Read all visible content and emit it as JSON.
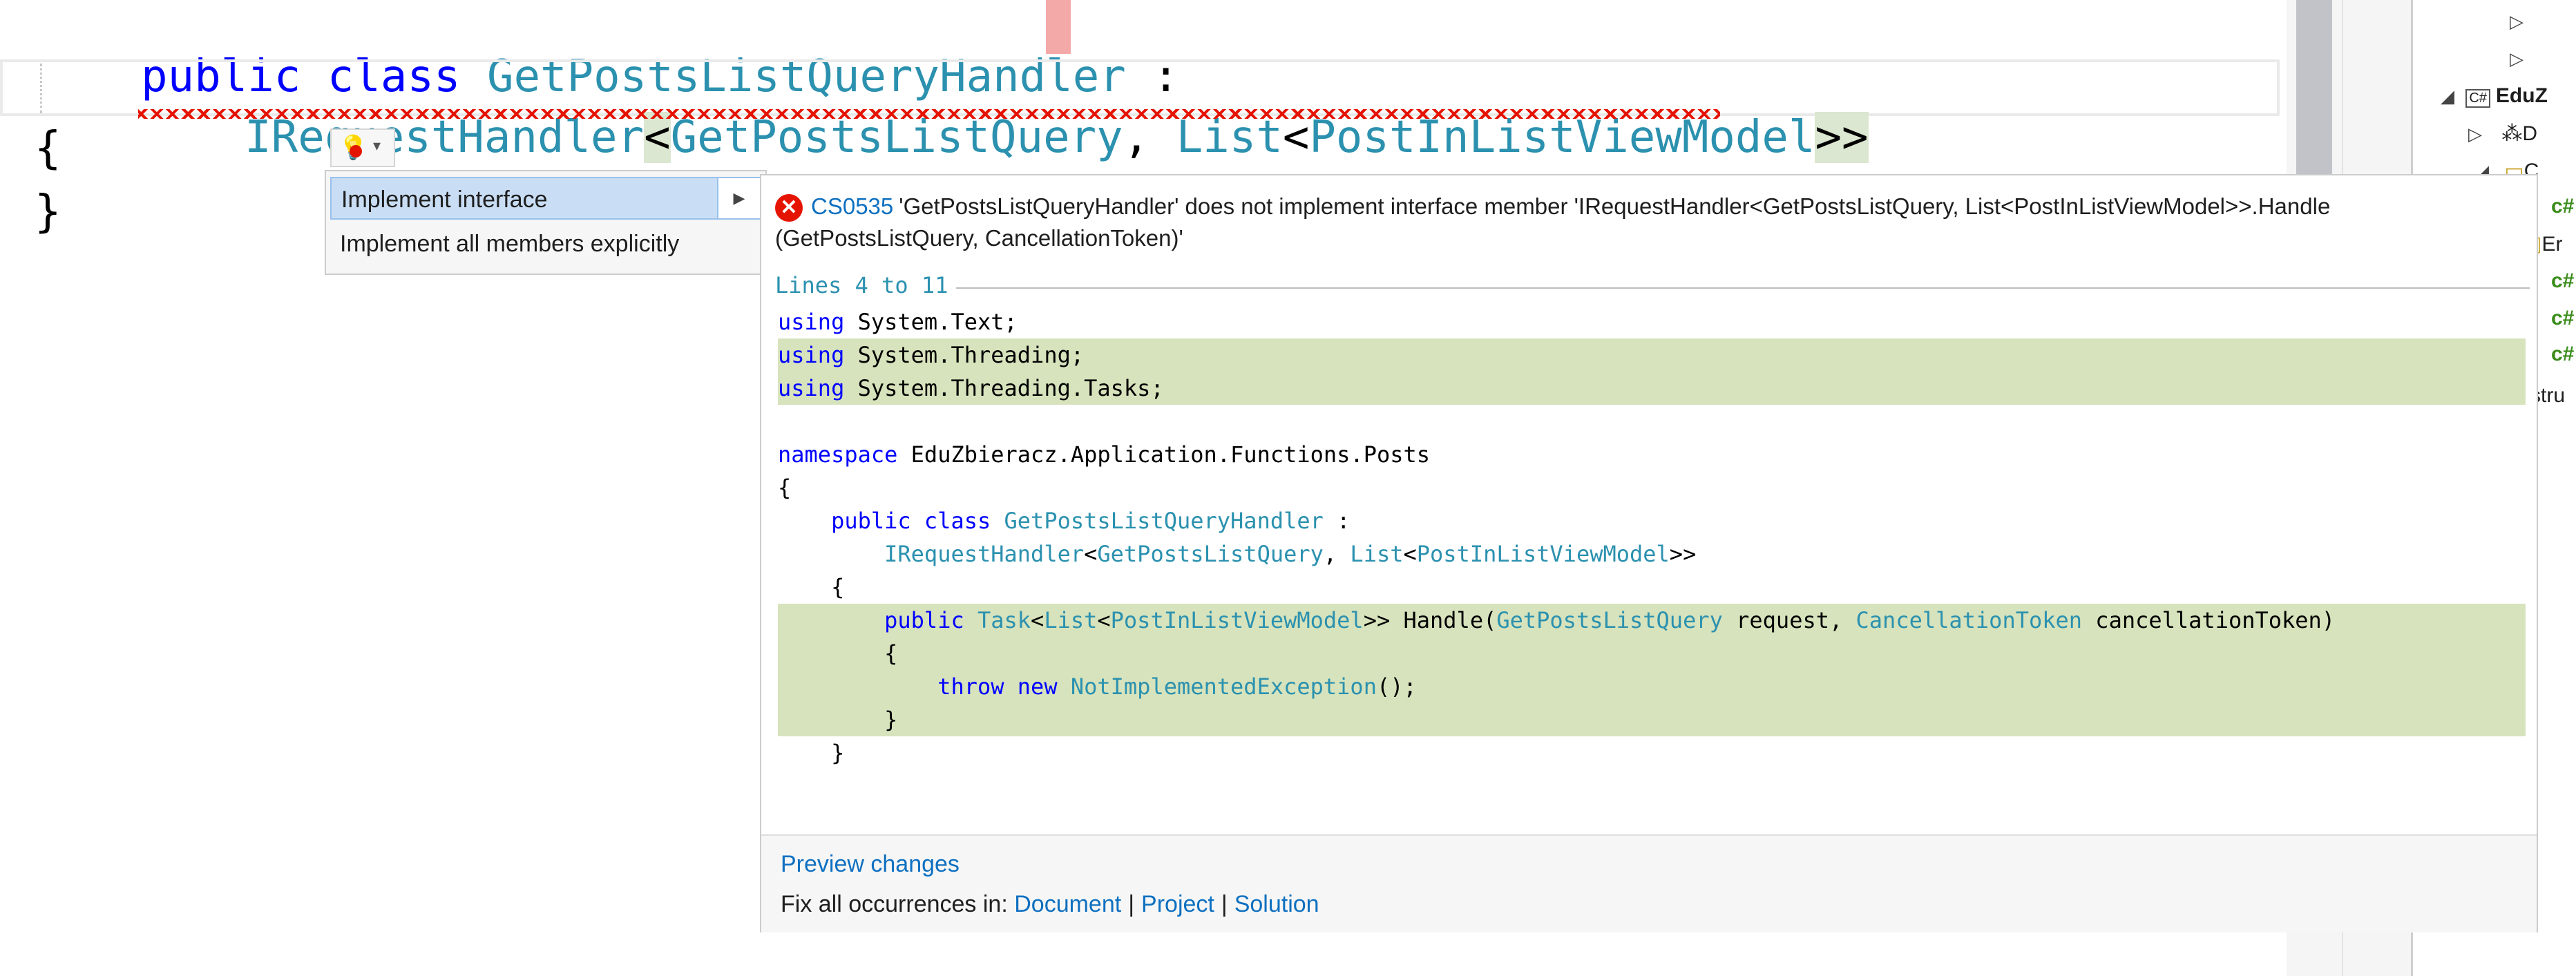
{
  "editor": {
    "line1": {
      "kw": "public class",
      "name": "GetPostsListQueryHandler",
      "colon": " :"
    },
    "line2": {
      "t1": "IRequestHandler",
      "lt": "<",
      "t2": "GetPostsListQuery",
      "comma": ", ",
      "t3": "List",
      "lt2": "<",
      "t4": "PostInListViewModel",
      "gt": ">>"
    },
    "line3": "{",
    "line4": "}"
  },
  "lightbulb": {
    "icon": "lightbulb-error-icon",
    "arrow": "▾"
  },
  "menu": {
    "items": [
      {
        "label": "Implement interface",
        "selected": true
      },
      {
        "label": "Implement all members explicitly",
        "selected": false
      }
    ],
    "submenu_arrow": "▶"
  },
  "preview": {
    "error_code": "CS0535",
    "error_message": "'GetPostsListQueryHandler' does not implement interface member 'IRequestHandler<GetPostsListQuery, List<PostInListViewModel>>.Handle (GetPostsListQuery, CancellationToken)'",
    "lines_label": "Lines 4 to 11",
    "code": [
      {
        "added": false,
        "segs": [
          {
            "c": "kw",
            "t": "using"
          },
          {
            "c": "pl",
            "t": " System.Text;"
          }
        ]
      },
      {
        "added": true,
        "segs": [
          {
            "c": "kw",
            "t": "using"
          },
          {
            "c": "pl",
            "t": " System.Threading;"
          }
        ]
      },
      {
        "added": true,
        "segs": [
          {
            "c": "kw",
            "t": "using"
          },
          {
            "c": "pl",
            "t": " System.Threading.Tasks;"
          }
        ]
      },
      {
        "added": false,
        "segs": []
      },
      {
        "added": false,
        "segs": [
          {
            "c": "kw",
            "t": "namespace"
          },
          {
            "c": "pl",
            "t": " EduZbieracz.Application.Functions.Posts"
          }
        ]
      },
      {
        "added": false,
        "segs": [
          {
            "c": "pl",
            "t": "{"
          }
        ]
      },
      {
        "added": false,
        "segs": [
          {
            "c": "pl",
            "t": "    "
          },
          {
            "c": "kw",
            "t": "public class"
          },
          {
            "c": "pl",
            "t": " "
          },
          {
            "c": "ty",
            "t": "GetPostsListQueryHandler"
          },
          {
            "c": "pl",
            "t": " :"
          }
        ]
      },
      {
        "added": false,
        "segs": [
          {
            "c": "pl",
            "t": "        "
          },
          {
            "c": "ty",
            "t": "IRequestHandler"
          },
          {
            "c": "pl",
            "t": "<"
          },
          {
            "c": "ty",
            "t": "GetPostsListQuery"
          },
          {
            "c": "pl",
            "t": ", "
          },
          {
            "c": "ty",
            "t": "List"
          },
          {
            "c": "pl",
            "t": "<"
          },
          {
            "c": "ty",
            "t": "PostInListViewModel"
          },
          {
            "c": "pl",
            "t": ">>"
          }
        ]
      },
      {
        "added": false,
        "segs": [
          {
            "c": "pl",
            "t": "    {"
          }
        ]
      },
      {
        "added": true,
        "segs": [
          {
            "c": "pl",
            "t": "        "
          },
          {
            "c": "kw",
            "t": "public"
          },
          {
            "c": "pl",
            "t": " "
          },
          {
            "c": "ty",
            "t": "Task"
          },
          {
            "c": "pl",
            "t": "<"
          },
          {
            "c": "ty",
            "t": "List"
          },
          {
            "c": "pl",
            "t": "<"
          },
          {
            "c": "ty",
            "t": "PostInListViewModel"
          },
          {
            "c": "pl",
            "t": ">> Handle("
          },
          {
            "c": "ty",
            "t": "GetPostsListQuery"
          },
          {
            "c": "pl",
            "t": " request, "
          },
          {
            "c": "ty",
            "t": "CancellationToken"
          },
          {
            "c": "pl",
            "t": " cancellationToken)"
          }
        ]
      },
      {
        "added": true,
        "segs": [
          {
            "c": "pl",
            "t": "        {"
          }
        ]
      },
      {
        "added": true,
        "segs": [
          {
            "c": "pl",
            "t": "            "
          },
          {
            "c": "kw",
            "t": "throw new"
          },
          {
            "c": "pl",
            "t": " "
          },
          {
            "c": "ty",
            "t": "NotImplementedException"
          },
          {
            "c": "pl",
            "t": "();"
          }
        ]
      },
      {
        "added": true,
        "segs": [
          {
            "c": "pl",
            "t": "        }"
          }
        ]
      },
      {
        "added": false,
        "segs": [
          {
            "c": "pl",
            "t": "    }"
          }
        ]
      }
    ],
    "preview_changes": "Preview changes",
    "fix_all_label": "Fix all occurrences in:",
    "fix_document": "Document",
    "fix_project": "Project",
    "fix_solution": "Solution",
    "separator": "|"
  },
  "solution_explorer": {
    "items": [
      {
        "arrow": "▷",
        "label": ""
      },
      {
        "arrow": "▷",
        "label": ""
      },
      {
        "arrow": "◢",
        "icon": "C#",
        "label": "EduZ"
      },
      {
        "arrow": "▷",
        "label": "D"
      },
      {
        "arrow": "◢",
        "label": "C"
      },
      {
        "arrow": "",
        "label": "c#"
      },
      {
        "arrow": "",
        "label": "Er"
      },
      {
        "arrow": "",
        "label": "c#"
      },
      {
        "arrow": "",
        "label": "c#"
      },
      {
        "arrow": "",
        "label": "c#"
      },
      {
        "arrow": "",
        "label": "stru"
      }
    ]
  },
  "colors": {
    "keyword": "#0000ff",
    "type": "#2b91af",
    "error": "#e51400",
    "link": "#0e70c0",
    "added_bg": "#d7e3bc",
    "selected_bg": "#c9def5"
  }
}
